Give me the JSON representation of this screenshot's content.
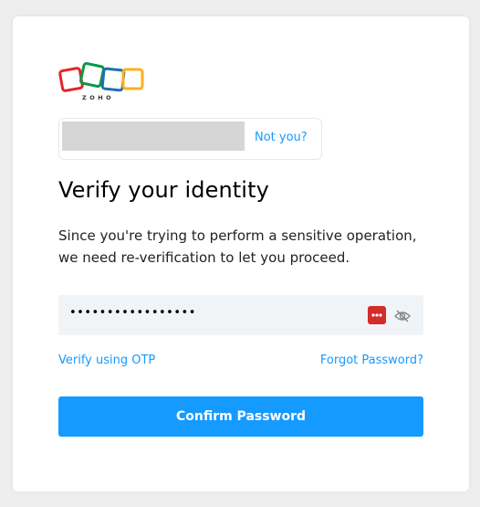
{
  "brand": {
    "logo_text": "ZOHO"
  },
  "account": {
    "not_you_label": "Not you?"
  },
  "title": "Verify your identity",
  "description": "Since you're trying to perform a sensitive operation, we need re-verification to let you proceed.",
  "password": {
    "value": "•••••••••••••••••"
  },
  "links": {
    "otp": "Verify using OTP",
    "forgot": "Forgot Password?"
  },
  "button": {
    "confirm": "Confirm Password"
  },
  "colors": {
    "accent": "#159aff",
    "password_manager": "#d42b2b",
    "field_bg": "#f1f4f7"
  },
  "icons": {
    "password_manager": "password-manager-icon",
    "visibility": "eye-slash-icon"
  }
}
